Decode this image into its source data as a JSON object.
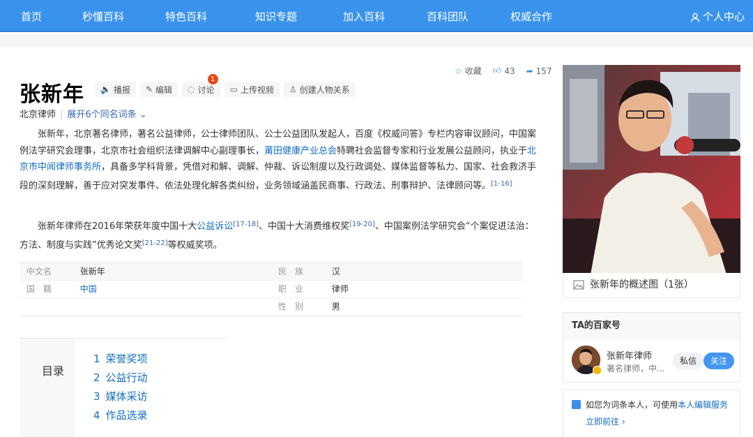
{
  "nav": {
    "items": [
      "首页",
      "秒懂百科",
      "特色百科",
      "知识专题",
      "加入百科",
      "百科团队",
      "权威合作"
    ],
    "user_center": "个人中心"
  },
  "entry": {
    "title": "张新年",
    "tools": {
      "play": "播报",
      "edit": "编辑",
      "discuss": "讨论",
      "discuss_badge": "1",
      "upload_video": "上传视频",
      "create_relation": "创建人物关系"
    },
    "stats": {
      "collect": "收藏",
      "likes": "43",
      "shares": "157"
    },
    "subtitle": "北京律师",
    "homonyms": "展开6个同名词条",
    "para1": {
      "t1": "张新年，北京著名律师，著名公益律师，公士律师团队、公士公益团队发起人，百度《权威问答》专栏内容审议顾问，中国案例法学研究会理事，北京市社会组织法律调解中心副理事长，",
      "link1": "莆田健康产业总会",
      "t2": "特聘社会监督专家和行业发展公益顾问，执业于",
      "link2": "北京市中闻律师事务所",
      "t3": "，具备多学科背景，凭借对和解、调解、仲裁、诉讼制度以及行政调处、媒体监督等私力、国家、社会救济手段的深刻理解，善于应对突发事件、依法处理化解各类纠纷，业务领域涵盖民商事、行政法、刑事辩护、法律顾问等。",
      "ref1": "[1-16]"
    },
    "para2": {
      "t1": "张新年律师在2016年荣获年度中国十大",
      "link1": "公益诉讼",
      "ref1": "[17-18]",
      "t2": "、中国十大消费维权奖",
      "ref2": "[19-20]",
      "t3": "、中国案例法学研究会“个案促进法治：方法、制度与实践”优秀论文奖",
      "ref3": "[21-22]",
      "t4": "等权威奖项。"
    },
    "info": {
      "rows": [
        {
          "k1": "中文名",
          "v1": "张新年",
          "k2": "民　族",
          "v2": "汉"
        },
        {
          "k1": "国　籍",
          "v1": "中国",
          "k2": "职　业",
          "v2": "律师"
        },
        {
          "k1": "",
          "v1": "",
          "k2": "性　别",
          "v2": "男"
        }
      ]
    },
    "toc": {
      "label": "目录",
      "items": [
        {
          "num": "1",
          "text": "荣誉奖项"
        },
        {
          "num": "2",
          "text": "公益行动"
        },
        {
          "num": "3",
          "text": "媒体采访"
        },
        {
          "num": "4",
          "text": "作品选录"
        }
      ]
    }
  },
  "sidebar": {
    "photo_caption": "张新年的概述图（1张）",
    "bjh": {
      "header": "TA的百家号",
      "name": "张新年律师",
      "desc": "著名律师，中...",
      "msg": "私信",
      "follow": "关注"
    },
    "claim": {
      "t1": "如您为词条本人，可使用",
      "link": "本人编辑服务",
      "t2": "立即前往 ›"
    }
  }
}
